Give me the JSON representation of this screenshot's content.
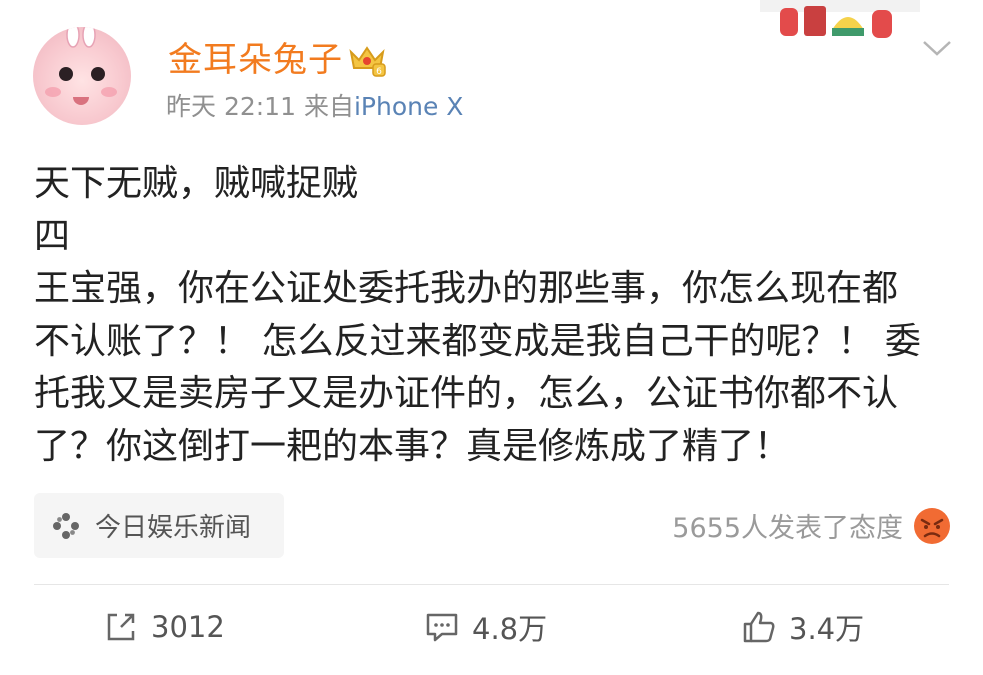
{
  "header": {
    "username": "金耳朵兔子",
    "time": "昨天 22:11",
    "source_prefix": "来自",
    "source": "iPhone X",
    "badge_icon": "crown-vip-icon",
    "menu_icon": "chevron-down-icon"
  },
  "post": {
    "lines": [
      "天下无贼，贼喊捉贼",
      "四",
      "王宝强，你在公证处委托我办的那些事，你怎么现在都",
      "不认账了？！ 怎么反过来都变成是我自己干的呢？！ 委",
      "托我又是卖房子又是办证件的，怎么，公证书你都不认",
      "了？你这倒打一耙的本事？真是修炼成了精了！"
    ]
  },
  "topic": {
    "label": "今日娱乐新闻",
    "icon": "pinwheel-icon"
  },
  "reaction": {
    "text": "5655人发表了态度",
    "icon": "angry-face-icon"
  },
  "actions": {
    "repost_count": "3012",
    "comment_count": "4.8万",
    "like_count": "3.4万"
  },
  "colors": {
    "username": "#f27b1f",
    "source_link": "#5a83b5",
    "meta": "#909090",
    "body_text": "#222222",
    "angry": "#f16b33"
  }
}
